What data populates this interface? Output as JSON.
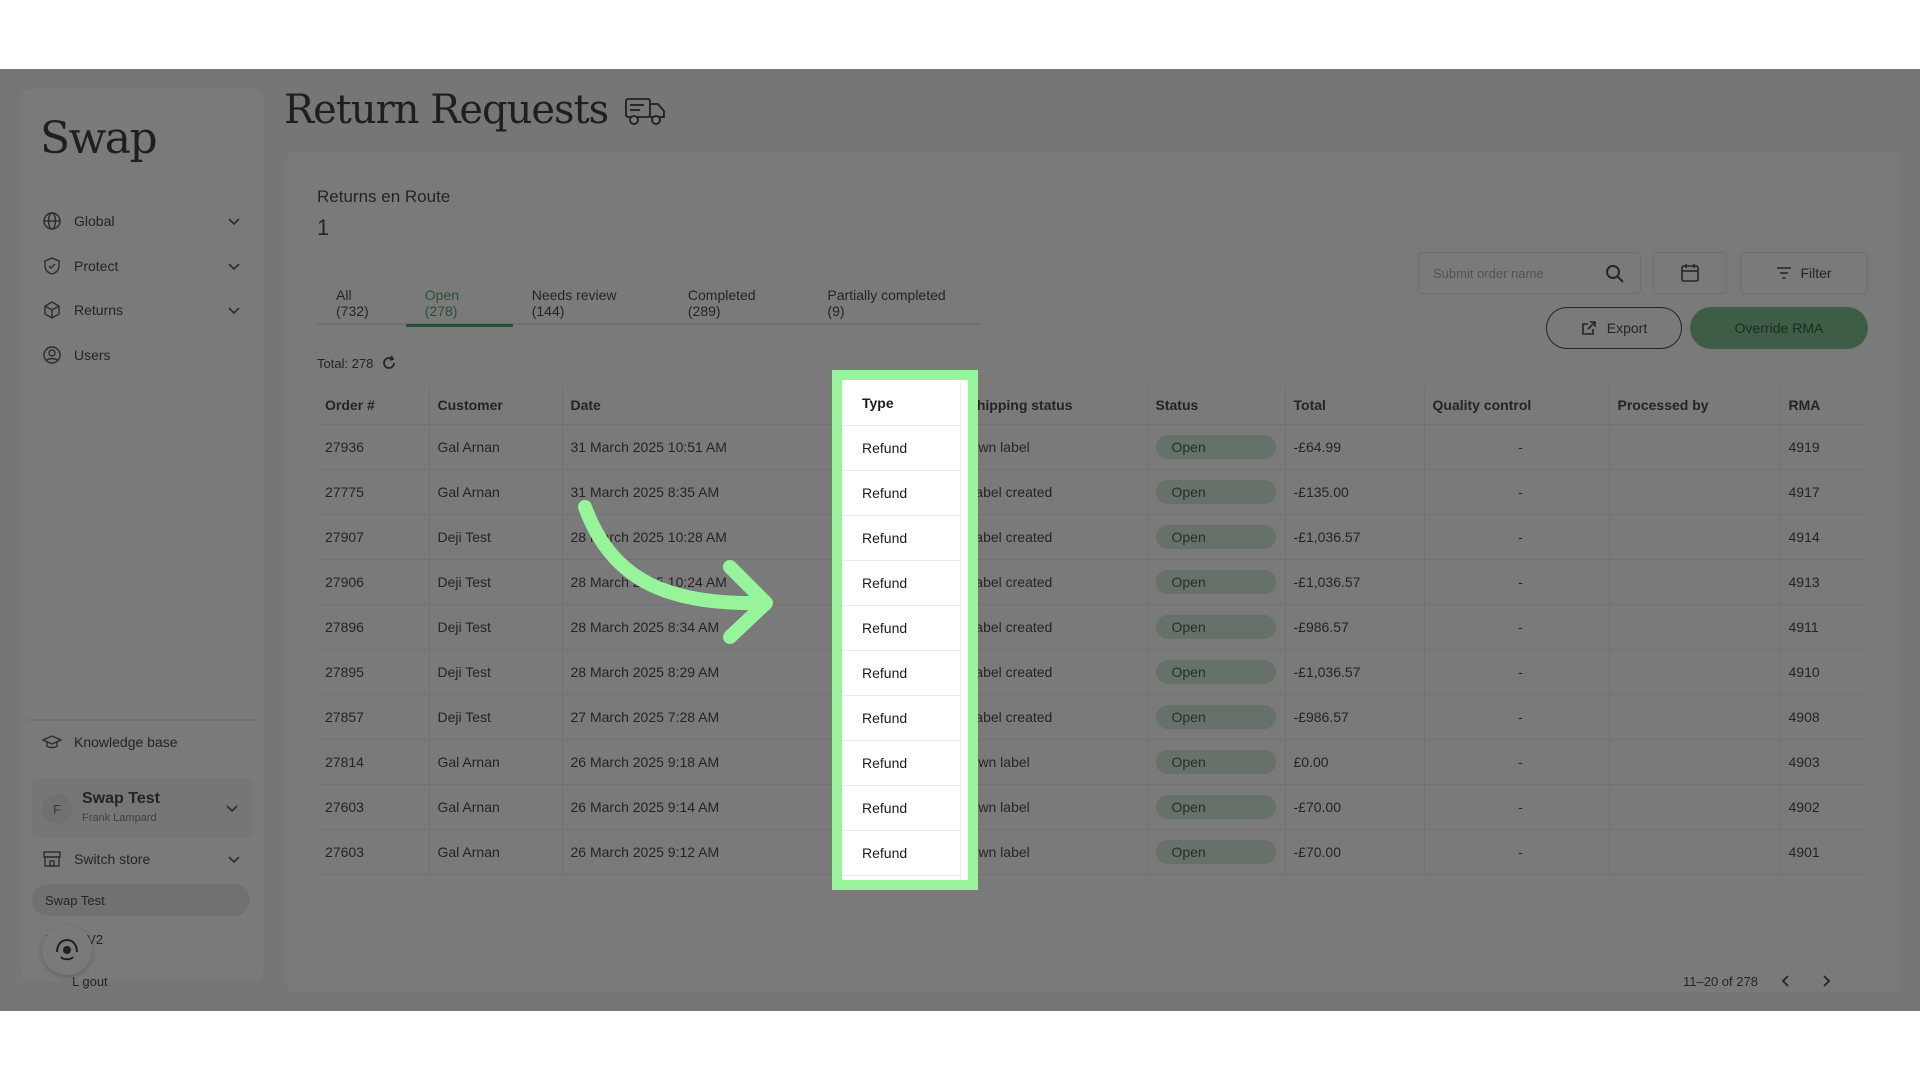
{
  "app": {
    "logo": "Swap",
    "page_title": "Return Requests"
  },
  "sidebar": {
    "items": [
      {
        "label": "Global",
        "icon": "globe-icon",
        "expandable": true
      },
      {
        "label": "Protect",
        "icon": "shield-icon",
        "expandable": true
      },
      {
        "label": "Returns",
        "icon": "box-icon",
        "expandable": true
      },
      {
        "label": "Users",
        "icon": "user-circle-icon",
        "expandable": false
      }
    ],
    "knowledge_base": "Knowledge base",
    "store": {
      "initial": "F",
      "name": "Swap Test",
      "owner": "Frank Lampard"
    },
    "switch_store": "Switch store",
    "store_options": [
      "Swap Test",
      "L    spire V2"
    ],
    "logout": "L     gout"
  },
  "metric": {
    "label": "Returns en Route",
    "value": "1"
  },
  "tabs": [
    {
      "label": "All (732)",
      "active": false
    },
    {
      "label": "Open (278)",
      "active": true
    },
    {
      "label": "Needs review (144)",
      "active": false
    },
    {
      "label": "Completed (289)",
      "active": false
    },
    {
      "label": "Partially completed (9)",
      "active": false
    }
  ],
  "toolbar": {
    "search_placeholder": "Submit order name",
    "filter_label": "Filter",
    "export_label": "Export",
    "override_label": "Override RMA"
  },
  "total_label": "Total: 278",
  "table": {
    "columns": [
      "Order #",
      "Customer",
      "Date",
      "Type",
      "Shipping status",
      "Status",
      "Total",
      "Quality control",
      "Processed by",
      "RMA"
    ],
    "rows": [
      {
        "order": "27936",
        "customer": "Gal Arnan",
        "date": "31 March 2025 10:51 AM",
        "type": "Refund",
        "shipping": "Own label",
        "status": "Open",
        "total": "-£64.99",
        "qc": "-",
        "processed_by": "",
        "rma": "4919"
      },
      {
        "order": "27775",
        "customer": "Gal Arnan",
        "date": "31 March 2025 8:35 AM",
        "type": "Refund",
        "shipping": "Label created",
        "status": "Open",
        "total": "-£135.00",
        "qc": "-",
        "processed_by": "",
        "rma": "4917"
      },
      {
        "order": "27907",
        "customer": "Deji Test",
        "date": "28 March 2025 10:28 AM",
        "type": "Refund",
        "shipping": "Label created",
        "status": "Open",
        "total": "-£1,036.57",
        "qc": "-",
        "processed_by": "",
        "rma": "4914"
      },
      {
        "order": "27906",
        "customer": "Deji Test",
        "date": "28 March 2025 10:24 AM",
        "type": "Refund",
        "shipping": "Label created",
        "status": "Open",
        "total": "-£1,036.57",
        "qc": "-",
        "processed_by": "",
        "rma": "4913"
      },
      {
        "order": "27896",
        "customer": "Deji Test",
        "date": "28 March 2025 8:34 AM",
        "type": "Refund",
        "shipping": "Label created",
        "status": "Open",
        "total": "-£986.57",
        "qc": "-",
        "processed_by": "",
        "rma": "4911"
      },
      {
        "order": "27895",
        "customer": "Deji Test",
        "date": "28 March 2025 8:29 AM",
        "type": "Refund",
        "shipping": "Label created",
        "status": "Open",
        "total": "-£1,036.57",
        "qc": "-",
        "processed_by": "",
        "rma": "4910"
      },
      {
        "order": "27857",
        "customer": "Deji Test",
        "date": "27 March 2025 7:28 AM",
        "type": "Refund",
        "shipping": "Label created",
        "status": "Open",
        "total": "-£986.57",
        "qc": "-",
        "processed_by": "",
        "rma": "4908"
      },
      {
        "order": "27814",
        "customer": "Gal Arnan",
        "date": "26 March 2025 9:18 AM",
        "type": "Refund",
        "shipping": "Own label",
        "status": "Open",
        "total": "£0.00",
        "qc": "-",
        "processed_by": "",
        "rma": "4903"
      },
      {
        "order": "27603",
        "customer": "Gal Arnan",
        "date": "26 March 2025 9:14 AM",
        "type": "Refund",
        "shipping": "Own label",
        "status": "Open",
        "total": "-£70.00",
        "qc": "-",
        "processed_by": "",
        "rma": "4902"
      },
      {
        "order": "27603",
        "customer": "Gal Arnan",
        "date": "26 March 2025 9:12 AM",
        "type": "Refund",
        "shipping": "Own label",
        "status": "Open",
        "total": "-£70.00",
        "qc": "-",
        "processed_by": "",
        "rma": "4901"
      }
    ]
  },
  "pagination": {
    "range": "11–20 of 278"
  },
  "colors": {
    "accent_green": "#2f8f4e",
    "button_green": "#5fb27a",
    "status_pill": "#cbe8d4",
    "highlight": "#98f49b",
    "background": "#f4f3ef"
  }
}
